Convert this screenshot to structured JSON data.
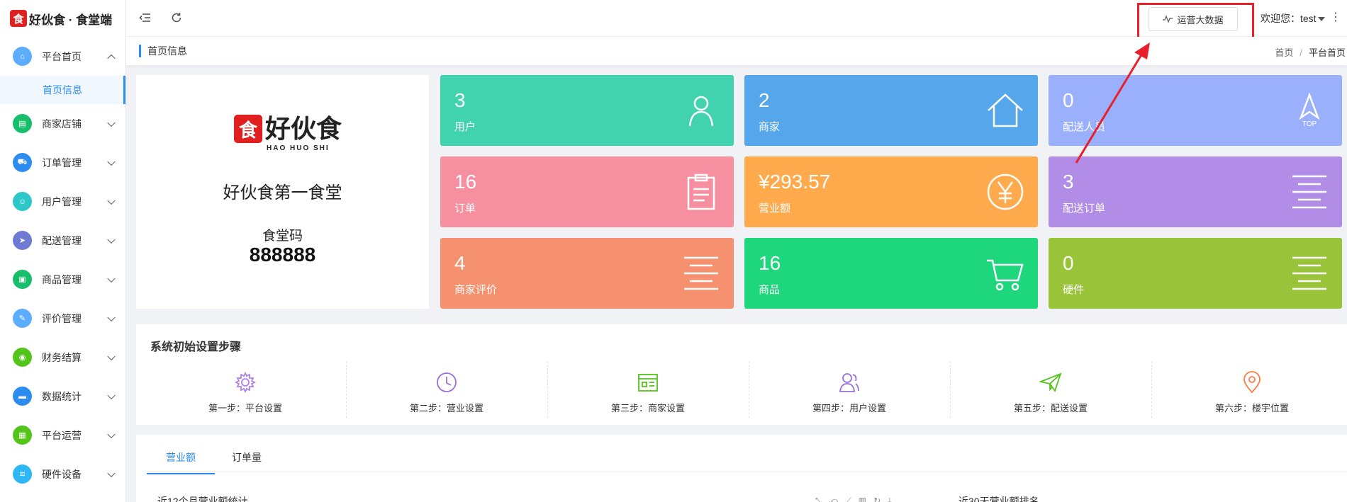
{
  "logo": {
    "text": "好伙食 · 食堂端",
    "mark": "食",
    "sub": "HAO HUO SHI"
  },
  "sidebar": {
    "items": [
      {
        "label": "平台首页",
        "color": "#5cadff",
        "expanded": true,
        "sub": [
          "首页信息"
        ]
      },
      {
        "label": "商家店铺",
        "color": "#19be6b"
      },
      {
        "label": "订单管理",
        "color": "#2d8cf0"
      },
      {
        "label": "用户管理",
        "color": "#2ec7c9"
      },
      {
        "label": "配送管理",
        "color": "#6f7ad3"
      },
      {
        "label": "商品管理",
        "color": "#19be6b"
      },
      {
        "label": "评价管理",
        "color": "#5cadff"
      },
      {
        "label": "财务结算",
        "color": "#52c41a"
      },
      {
        "label": "数据统计",
        "color": "#2d8cf0"
      },
      {
        "label": "平台运营",
        "color": "#52c41a"
      },
      {
        "label": "硬件设备",
        "color": "#2db7f5"
      }
    ]
  },
  "topbar": {
    "bigdata_label": "运营大数据",
    "welcome": "欢迎您：test"
  },
  "breadcrumb": {
    "title": "首页信息",
    "home": "首页",
    "sep": "/",
    "current": "平台首页"
  },
  "store": {
    "logo_text": "好伙食",
    "logo_sub": "HAO HUO SHI",
    "name": "好伙食第一食堂",
    "code_label": "食堂码",
    "code": "888888"
  },
  "tiles": [
    {
      "value": "3",
      "label": "用户",
      "color": "#41d3ae",
      "icon": "user-icon"
    },
    {
      "value": "2",
      "label": "商家",
      "color": "#55a6ea",
      "icon": "home-icon"
    },
    {
      "value": "0",
      "label": "配送人员",
      "color": "#9bb0fc",
      "icon": "top-icon",
      "icon_text": "TOP"
    },
    {
      "value": "16",
      "label": "订单",
      "color": "#f68fa0",
      "icon": "clipboard-icon"
    },
    {
      "value": "¥293.57",
      "label": "营业额",
      "color": "#ffaa4c",
      "icon": "yen-icon"
    },
    {
      "value": "3",
      "label": "配送订单",
      "color": "#b18de8",
      "icon": "lines-icon"
    },
    {
      "value": "4",
      "label": "商家评价",
      "color": "#f5916f",
      "icon": "lines-icon"
    },
    {
      "value": "16",
      "label": "商品",
      "color": "#1ed67c",
      "icon": "cart-icon"
    },
    {
      "value": "0",
      "label": "硬件",
      "color": "#99c43a",
      "icon": "lines-icon"
    }
  ],
  "setup": {
    "title": "系统初始设置步骤",
    "steps": [
      {
        "label": "第一步：平台设置",
        "icon": "gear-icon",
        "color": "#b37feb"
      },
      {
        "label": "第二步：营业设置",
        "icon": "clock-icon",
        "color": "#9b6fd8"
      },
      {
        "label": "第三步：商家设置",
        "icon": "store-icon",
        "color": "#52c41a"
      },
      {
        "label": "第四步：用户设置",
        "icon": "users-icon",
        "color": "#9b6fd8"
      },
      {
        "label": "第五步：配送设置",
        "icon": "send-icon",
        "color": "#52c41a"
      },
      {
        "label": "第六步：楼宇位置",
        "icon": "location-icon",
        "color": "#ff7a45"
      }
    ]
  },
  "tabs": {
    "items": [
      "营业额",
      "订单量"
    ],
    "active": 0
  },
  "charts": {
    "left_title": "近12个月营业额统计",
    "right_title": "近30天营业额排名"
  }
}
